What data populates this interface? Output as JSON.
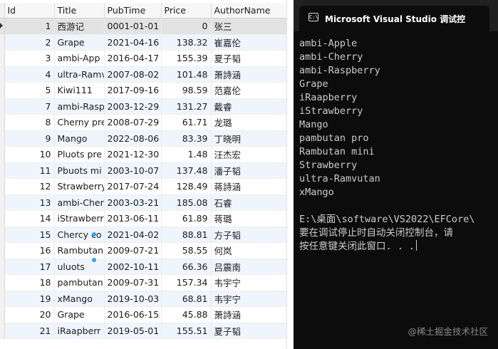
{
  "grid": {
    "columns": [
      "Id",
      "Title",
      "PubTime",
      "Price",
      "AuthorName"
    ],
    "rows": [
      {
        "id": "1",
        "title": "西游记",
        "pubtime": "0001-01-01",
        "price": "0",
        "author": "张三"
      },
      {
        "id": "2",
        "title": "Grape",
        "pubtime": "2021-04-16",
        "price": "138.32",
        "author": "崔嘉伦"
      },
      {
        "id": "3",
        "title": "ambi-App",
        "pubtime": "2016-04-17",
        "price": "155.39",
        "author": "夏子韬"
      },
      {
        "id": "4",
        "title": "ultra-Ramv",
        "pubtime": "2007-08-02",
        "price": "101.48",
        "author": "萧詩涵"
      },
      {
        "id": "5",
        "title": "Kiwi111",
        "pubtime": "2017-09-16",
        "price": "98.59",
        "author": "范嘉伦"
      },
      {
        "id": "7",
        "title": "ambi-Rasp",
        "pubtime": "2003-12-29",
        "price": "131.27",
        "author": "戴睿"
      },
      {
        "id": "8",
        "title": "Cherny pre",
        "pubtime": "2008-07-29",
        "price": "61.71",
        "author": "龙璐"
      },
      {
        "id": "9",
        "title": "Mango",
        "pubtime": "2022-08-06",
        "price": "83.39",
        "author": "丁晓明"
      },
      {
        "id": "10",
        "title": "Pluots pre",
        "pubtime": "2021-12-30",
        "price": "1.48",
        "author": "汪杰宏"
      },
      {
        "id": "11",
        "title": "Pbuots mi",
        "pubtime": "2003-10-07",
        "price": "137.48",
        "author": "潘子韬"
      },
      {
        "id": "12",
        "title": "Strawberry",
        "pubtime": "2017-07-24",
        "price": "128.49",
        "author": "蒋詩涵"
      },
      {
        "id": "13",
        "title": "ambi-Cher",
        "pubtime": "2003-03-21",
        "price": "185.08",
        "author": "石睿"
      },
      {
        "id": "14",
        "title": "iStrawberr",
        "pubtime": "2013-06-11",
        "price": "61.89",
        "author": "蒋璐"
      },
      {
        "id": "15",
        "title": "Chercy co",
        "pubtime": "2021-04-02",
        "price": "88.81",
        "author": "方子韬"
      },
      {
        "id": "16",
        "title": "Rambutan",
        "pubtime": "2009-07-21",
        "price": "58.55",
        "author": "何岚"
      },
      {
        "id": "17",
        "title": "uluots",
        "pubtime": "2002-10-11",
        "price": "66.36",
        "author": "吕震南"
      },
      {
        "id": "18",
        "title": "pambutan",
        "pubtime": "2009-07-31",
        "price": "157.34",
        "author": "韦宇宁"
      },
      {
        "id": "19",
        "title": "xMango",
        "pubtime": "2019-10-03",
        "price": "68.81",
        "author": "韦宇宁"
      },
      {
        "id": "20",
        "title": "Grape",
        "pubtime": "2016-06-15",
        "price": "45.88",
        "author": "萧詩涵"
      },
      {
        "id": "21",
        "title": "iRaapberr",
        "pubtime": "2019-05-01",
        "price": "155.51",
        "author": "夏子韬"
      }
    ]
  },
  "console": {
    "tab_title": "Microsoft Visual Studio 调试控",
    "icon_glyph": "C:\\",
    "new_tab_label": "+",
    "lines": [
      "ambi-Apple",
      "ambi-Cherry",
      "ambi-Raspberry",
      "Grape",
      "iRaapberry",
      "iStrawberry",
      "Mango",
      "pambutan pro",
      "Rambutan mini",
      "Strawberry",
      "ultra-Ramvutan",
      "xMango",
      "",
      "E:\\桌面\\software\\VS2022\\EFCore\\",
      "要在调试停止时自动关闭控制台，请",
      "按任意键关闭此窗口. . ."
    ]
  },
  "watermark": "@稀土掘金技术社区",
  "colors": {
    "console_bg": "#0c0c0c",
    "titlebar_bg": "#202020",
    "selected_row": "#e3e3e3",
    "alt_row": "#eef5fc"
  }
}
